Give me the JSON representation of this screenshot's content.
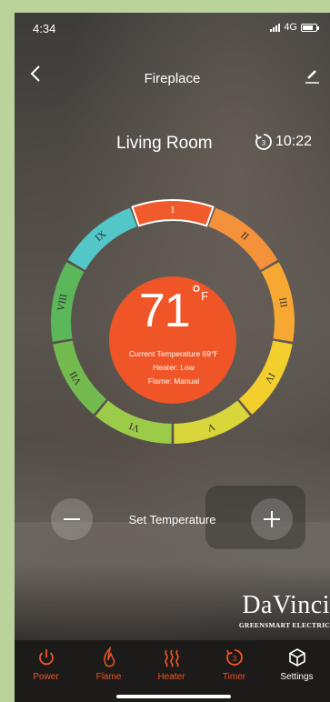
{
  "status": {
    "time": "4:34",
    "network": "4G"
  },
  "header": {
    "title": "Fireplace"
  },
  "room": {
    "name": "Living Room"
  },
  "timer": {
    "value": "10:22"
  },
  "dial": {
    "segments": [
      "I",
      "II",
      "III",
      "IV",
      "V",
      "VI",
      "VII",
      "VIII",
      "IX"
    ],
    "active_segment": "I",
    "colors": [
      "#f15a2a",
      "#f4913b",
      "#f7a832",
      "#f3cf2d",
      "#d8d63a",
      "#9ccb4a",
      "#74bb4f",
      "#5cb65a",
      "#53c7c7"
    ]
  },
  "thermostat": {
    "set_temp": "71",
    "unit": "F",
    "degree": "°",
    "current_temp": "Current Temperature 69℉",
    "heater": "Heater: Low",
    "flame": "Flame: Manual",
    "disc_color": "#ef5527"
  },
  "controls": {
    "set_label": "Set Temperature"
  },
  "brand": {
    "name": "DaVinci",
    "tagline": "GREENSMART ELECTRIC"
  },
  "tabs": [
    {
      "label": "Power",
      "icon": "power-icon"
    },
    {
      "label": "Flame",
      "icon": "flame-icon"
    },
    {
      "label": "Heater",
      "icon": "heater-icon"
    },
    {
      "label": "Timer",
      "icon": "timer-icon"
    },
    {
      "label": "Settings",
      "icon": "cube-icon"
    }
  ],
  "colors": {
    "accent": "#ef5527",
    "tabbar": "#1c1b1a"
  }
}
